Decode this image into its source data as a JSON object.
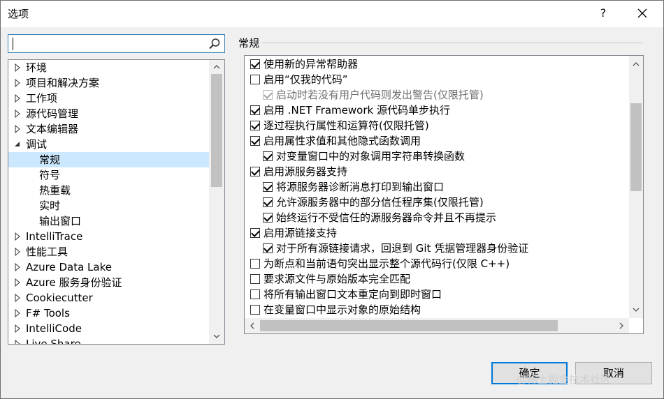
{
  "window": {
    "title": "选项",
    "help": "?",
    "close_icon": "close-icon"
  },
  "search": {
    "value": "",
    "placeholder": ""
  },
  "tree": {
    "items": [
      {
        "label": "环境",
        "expanded": false
      },
      {
        "label": "项目和解决方案",
        "expanded": false
      },
      {
        "label": "工作项",
        "expanded": false
      },
      {
        "label": "源代码管理",
        "expanded": false
      },
      {
        "label": "文本编辑器",
        "expanded": false
      },
      {
        "label": "调试",
        "expanded": true
      },
      {
        "label": "常规",
        "child": true,
        "selected": true
      },
      {
        "label": "符号",
        "child": true
      },
      {
        "label": "热重载",
        "child": true
      },
      {
        "label": "实时",
        "child": true
      },
      {
        "label": "输出窗口",
        "child": true
      },
      {
        "label": "IntelliTrace",
        "expanded": false
      },
      {
        "label": "性能工具",
        "expanded": false
      },
      {
        "label": "Azure Data Lake",
        "expanded": false
      },
      {
        "label": "Azure 服务身份验证",
        "expanded": false
      },
      {
        "label": "Cookiecutter",
        "expanded": false
      },
      {
        "label": "F# Tools",
        "expanded": false
      },
      {
        "label": "IntelliCode",
        "expanded": false
      },
      {
        "label": "Live Share",
        "expanded": false
      }
    ]
  },
  "section": {
    "title": "常规"
  },
  "options": [
    {
      "label": "使用新的异常帮助器",
      "checked": true,
      "indent": 0
    },
    {
      "label": "启用“仅我的代码”",
      "checked": false,
      "indent": 0
    },
    {
      "label": "启动时若没有用户代码则发出警告(仅限托管)",
      "checked": true,
      "indent": 1,
      "disabled": true
    },
    {
      "label": "启用 .NET Framework 源代码单步执行",
      "checked": true,
      "indent": 0
    },
    {
      "label": "逐过程执行属性和运算符(仅限托管)",
      "checked": true,
      "indent": 0
    },
    {
      "label": "启用属性求值和其他隐式函数调用",
      "checked": true,
      "indent": 0
    },
    {
      "label": "对变量窗口中的对象调用字符串转换函数",
      "checked": true,
      "indent": 1
    },
    {
      "label": "启用源服务器支持",
      "checked": true,
      "indent": 0
    },
    {
      "label": "将源服务器诊断消息打印到输出窗口",
      "checked": true,
      "indent": 1
    },
    {
      "label": "允许源服务器中的部分信任程序集(仅限托管)",
      "checked": true,
      "indent": 1
    },
    {
      "label": "始终运行不受信任的源服务器命令并且不再提示",
      "checked": true,
      "indent": 1
    },
    {
      "label": "启用源链接支持",
      "checked": true,
      "indent": 0
    },
    {
      "label": "对于所有源链接请求，回退到 Git 凭据管理器身份验证",
      "checked": true,
      "indent": 1
    },
    {
      "label": "为断点和当前语句突出显示整个源代码行(仅限 C++)",
      "checked": false,
      "indent": 0
    },
    {
      "label": "要求源文件与原始版本完全匹配",
      "checked": false,
      "indent": 0
    },
    {
      "label": "将所有输出窗口文本重定向到即时窗口",
      "checked": false,
      "indent": 0
    },
    {
      "label": "在变量窗口中显示对象的原始结构",
      "checked": false,
      "indent": 0
    }
  ],
  "buttons": {
    "ok": "确定",
    "cancel": "取消"
  },
  "watermark": "@稀土掘金技术社区"
}
